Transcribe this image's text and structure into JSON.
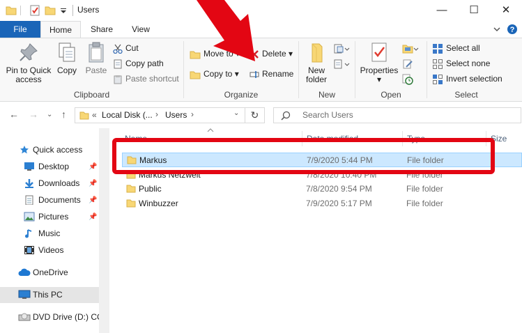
{
  "window": {
    "title": "Users",
    "controls": {
      "minimize": "—",
      "maximize": "☐",
      "close": "✕"
    }
  },
  "ribbon_tabs": [
    {
      "label": "File"
    },
    {
      "label": "Home"
    },
    {
      "label": "Share"
    },
    {
      "label": "View"
    }
  ],
  "ribbon": {
    "clipboard": {
      "group_label": "Clipboard",
      "pin_label_1": "Pin to Quick",
      "pin_label_2": "access",
      "copy": "Copy",
      "paste": "Paste",
      "cut": "Cut",
      "copy_path": "Copy path",
      "paste_shortcut": "Paste shortcut"
    },
    "organize": {
      "group_label": "Organize",
      "move_to": "Move to",
      "copy_to": "Copy to",
      "delete": "Delete",
      "rename": "Rename"
    },
    "new": {
      "group_label": "New",
      "new_folder_1": "New",
      "new_folder_2": "folder"
    },
    "open": {
      "group_label": "Open",
      "properties": "Properties"
    },
    "select": {
      "group_label": "Select",
      "select_all": "Select all",
      "select_none": "Select none",
      "invert_selection": "Invert selection"
    }
  },
  "address": {
    "overflow": "«",
    "crumb_1": "Local Disk (...",
    "crumb_sep_1": "›",
    "crumb_2": "Users",
    "crumb_sep_2": "›",
    "search_placeholder": "Search Users"
  },
  "nav_pane": {
    "items": [
      {
        "label": "Quick access"
      },
      {
        "label": "Desktop"
      },
      {
        "label": "Downloads"
      },
      {
        "label": "Documents"
      },
      {
        "label": "Pictures"
      },
      {
        "label": "Music"
      },
      {
        "label": "Videos"
      },
      {
        "label": "OneDrive"
      },
      {
        "label": "This PC"
      },
      {
        "label": "DVD Drive (D:) CC"
      }
    ]
  },
  "file_list": {
    "columns": [
      "Name",
      "Date modified",
      "Type",
      "Size"
    ],
    "rows": [
      {
        "name": "Markus",
        "date": "7/9/2020 5:44 PM",
        "type": "File folder",
        "selected": true
      },
      {
        "name": "Markus Netzwelt",
        "date": "7/8/2020 10:40 PM",
        "type": "File folder",
        "selected": false
      },
      {
        "name": "Public",
        "date": "7/8/2020 9:54 PM",
        "type": "File folder",
        "selected": false
      },
      {
        "name": "Winbuzzer",
        "date": "7/9/2020 5:17 PM",
        "type": "File folder",
        "selected": false
      }
    ]
  },
  "colors": {
    "annotation": "#e30613",
    "file_tab": "#1a65b8",
    "selection": "#cce8ff",
    "folder": "#f8d775"
  }
}
